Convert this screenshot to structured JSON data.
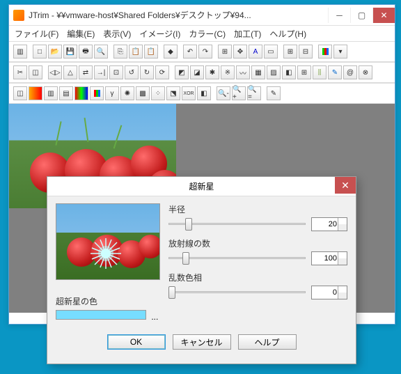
{
  "window": {
    "title": "JTrim - ¥¥vmware-host¥Shared Folders¥デスクトップ¥94..."
  },
  "menu": {
    "file": "ファイル(F)",
    "edit": "編集(E)",
    "view": "表示(V)",
    "image": "イメージ(I)",
    "color": "カラー(C)",
    "effect": "加工(T)",
    "help": "ヘルプ(H)"
  },
  "dialog": {
    "title": "超新星",
    "radius_label": "半径",
    "radius_value": "20",
    "rays_label": "放射線の数",
    "rays_value": "100",
    "hue_label": "乱数色相",
    "hue_value": "0",
    "color_label": "超新星の色",
    "ok": "OK",
    "cancel": "キャンセル",
    "help": "ヘルプ"
  }
}
